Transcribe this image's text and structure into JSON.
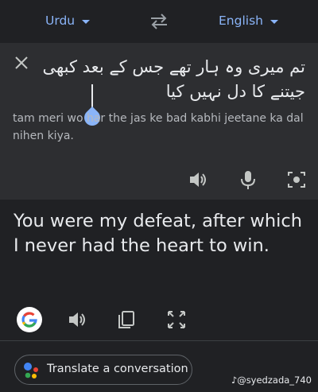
{
  "languages": {
    "source": "Urdu",
    "target": "English"
  },
  "source": {
    "text": "تم میری وہ ہار تھے جس کے بعد کبھی جیتنے کا دل نہیں کیا",
    "transliteration": "tam meri wo har the jas ke bad kabhi jeetane ka dal nihen kiya."
  },
  "translation": {
    "text": "You were my defeat, after which I never had the heart to win."
  },
  "footer": {
    "conversation_label": "Translate a conversation"
  },
  "watermark": "@syedzada_740",
  "colors": {
    "accent": "#8ab4f8",
    "panel": "#2d2e31",
    "background": "#202124"
  },
  "icons": [
    "swap-icon",
    "close-icon",
    "speaker-icon",
    "mic-icon",
    "camera-icon",
    "google-icon",
    "copy-icon",
    "fullscreen-icon",
    "assistant-icon",
    "tiktok-icon"
  ]
}
